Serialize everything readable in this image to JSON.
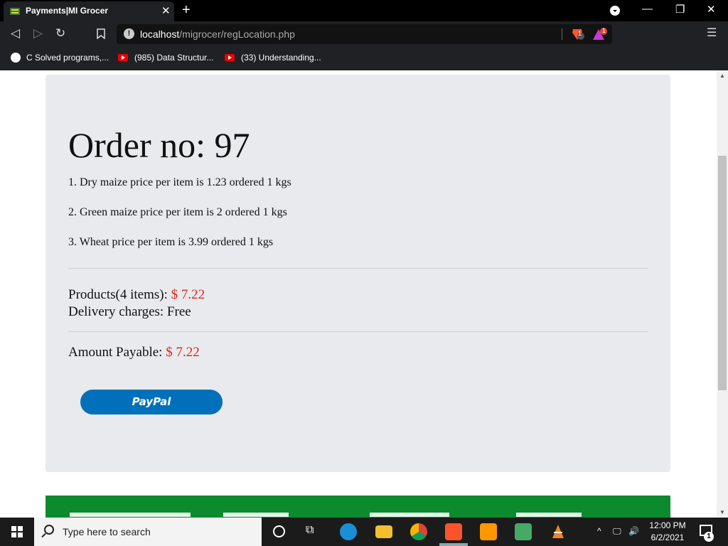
{
  "browser": {
    "tab_title": "Payments|MI Grocer",
    "url_host": "localhost",
    "url_path": "/migrocer/regLocation.php",
    "shield_count": "1",
    "rewards_count": "1",
    "bookmarks": [
      {
        "label": "C Solved programs,..."
      },
      {
        "label": "(985) Data Structur..."
      },
      {
        "label": "(33) Understanding..."
      }
    ]
  },
  "page": {
    "order_title": "Order no: 97",
    "items": [
      "1. Dry maize price per item is 1.23 ordered 1 kgs",
      "2. Green maize price per item is 2 ordered 1 kgs",
      "3. Wheat price per item is 3.99 ordered 1 kgs"
    ],
    "products_label": "Products(4 items): ",
    "products_price": "$ 7.22",
    "delivery_text": "Delivery charges: Free",
    "amount_label": "Amount Payable: ",
    "amount_price": "$ 7.22",
    "paypal_label": "PayPal",
    "colors": {
      "price": "#e0241a",
      "footer": "#0b8a2e",
      "paypal": "#0070ba"
    }
  },
  "taskbar": {
    "search_placeholder": "Type here to search",
    "time": "12:00 PM",
    "date": "6/2/2021",
    "notification_count": "1",
    "apps": [
      "cortana-icon",
      "task-view-icon",
      "edge-icon",
      "file-explorer-icon",
      "chrome-icon",
      "brave-icon",
      "sublime-icon",
      "snipping-icon",
      "vlc-icon"
    ]
  }
}
